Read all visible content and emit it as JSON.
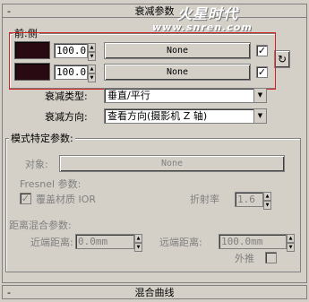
{
  "watermark": {
    "line1": "火星时代",
    "line2": "www.snren.com"
  },
  "falloff_rollout": {
    "title": "衰减参数",
    "collapse_symbol": "-"
  },
  "front_side": {
    "label": "前:侧",
    "rows": [
      {
        "value": "100.0",
        "map_label": "None",
        "checked": "✓"
      },
      {
        "value": "100.0",
        "map_label": "None",
        "checked": "✓"
      }
    ],
    "swap_symbol": "↻",
    "front_color": "#2a0a12"
  },
  "falloff_type": {
    "label": "衰减类型:",
    "value": "垂直/平行"
  },
  "falloff_direction": {
    "label": "衰减方向:",
    "value": "查看方向(摄影机 Z 轴)"
  },
  "mode_params": {
    "title": "模式特定参数:",
    "object_label": "对象:",
    "object_button": "None",
    "fresnel_label": "Fresnel 参数:",
    "override_ior_check": "✓",
    "override_ior_label": "覆盖材质 IOR",
    "ior_label": "折射率",
    "ior_value": "1.6",
    "distance_blend_label": "距离混合参数:",
    "near_label": "近端距离:",
    "near_value": "0.0mm",
    "far_label": "远端距离:",
    "far_value": "100.0mm",
    "extrapolate_label": "外推"
  },
  "mix_curve_rollout": {
    "title": "混合曲线",
    "collapse_symbol": "-"
  },
  "colors": {
    "panel_bg": "#d4d0c8",
    "highlight_frame": "#d02020",
    "disabled_text": "#808080"
  }
}
